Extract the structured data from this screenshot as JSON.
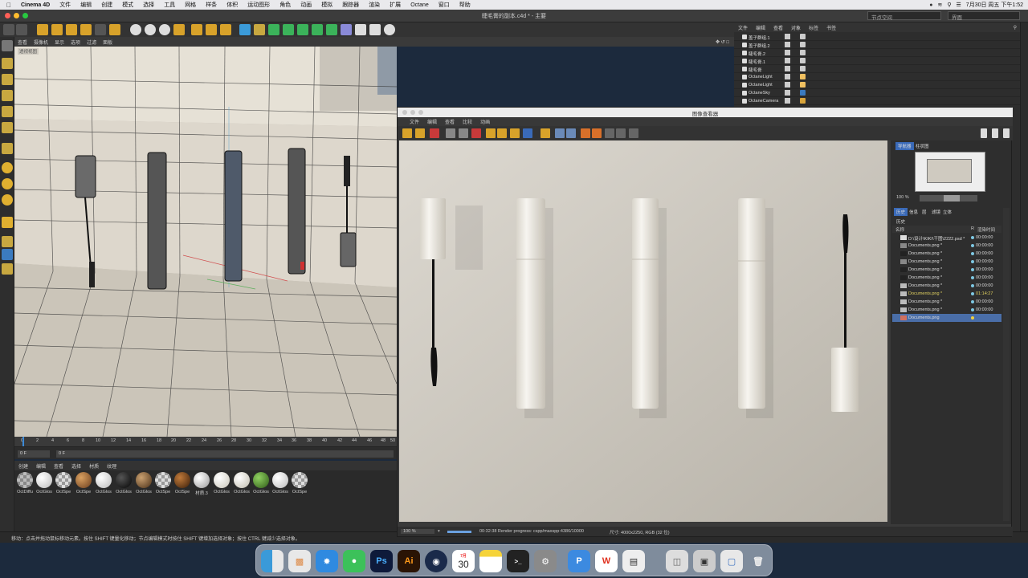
{
  "menubar": {
    "apple": "",
    "app": "Cinema 4D",
    "items": [
      "文件",
      "编辑",
      "创建",
      "模式",
      "选择",
      "工具",
      "网格",
      "样条",
      "体积",
      "运动图形",
      "角色",
      "动画",
      "模拟",
      "跟踪器",
      "渲染",
      "扩展",
      "Octane",
      "窗口",
      "帮助"
    ],
    "clock": "7月30日 周五 下午1:52"
  },
  "window": {
    "title": "睫毛膏的副本.c4d * - 主要",
    "search_left": "节点空间",
    "search_right": "界面"
  },
  "viewport": {
    "menu": [
      "查看",
      "摄像机",
      "显示",
      "选项",
      "过滤",
      "面板"
    ],
    "corner_label": "透视视图"
  },
  "timeline": {
    "ticks": [
      "0",
      "2",
      "4",
      "6",
      "8",
      "10",
      "12",
      "14",
      "16",
      "18",
      "20",
      "22",
      "24",
      "26",
      "28",
      "30",
      "32",
      "34",
      "36",
      "38",
      "40",
      "42",
      "44",
      "46",
      "48",
      "50"
    ],
    "frame_start": "0 F",
    "frame_current": "0 F"
  },
  "material_manager": {
    "menu": [
      "创建",
      "编辑",
      "查看",
      "选择",
      "材质",
      "纹理"
    ],
    "materials": [
      {
        "label": "OctDiffu",
        "color": "#9a9a9a"
      },
      {
        "label": "OctGlos",
        "color": "#e6e6e6"
      },
      {
        "label": "OctSpe",
        "color": "#bfbfbf"
      },
      {
        "label": "OctSpe",
        "color": "#8a5a2b"
      },
      {
        "label": "OctGlos",
        "color": "#e8e8e8"
      },
      {
        "label": "OctGlos",
        "color": "#1a1a1a"
      },
      {
        "label": "OctGlos",
        "color": "#7a5a35"
      },
      {
        "label": "OctSpe",
        "color": "#bdbdbd"
      },
      {
        "label": "OctSpe",
        "color": "#6b3e1e"
      },
      {
        "label": "材质.3",
        "color": "#cfcfcf"
      },
      {
        "label": "OctGlos",
        "color": "#e2e0da"
      },
      {
        "label": "OctGlos",
        "color": "#dcd9d0"
      },
      {
        "label": "OctGlos",
        "color": "#4f8a2e"
      },
      {
        "label": "OctGlos",
        "color": "#e4e4e4"
      },
      {
        "label": "OctSpe",
        "color": "#bcbcbc"
      }
    ]
  },
  "statusbar": {
    "text": "移动：点击并拖动鼠标移动元素。按住 SHIFT 键量化移动；节点编辑模式时按住 SHIFT 键增加选择对象；按住 CTRL 键减少选择对象。"
  },
  "object_manager": {
    "menu": [
      "文件",
      "编辑",
      "查看",
      "对象",
      "标签",
      "书签"
    ],
    "objects": [
      {
        "name": "盖子群组.1",
        "tag": "#cccccc"
      },
      {
        "name": "盖子群组.2",
        "tag": "#cccccc"
      },
      {
        "name": "睫毛膏.2",
        "tag": "#cccccc"
      },
      {
        "name": "睫毛膏.1",
        "tag": "#cccccc"
      },
      {
        "name": "睫毛膏",
        "tag": "#cccccc"
      },
      {
        "name": "OctaneLight",
        "tag": "#f0c060"
      },
      {
        "name": "OctaneLight",
        "tag": "#f0c060"
      },
      {
        "name": "OctaneSky",
        "tag": "#3a7abf"
      },
      {
        "name": "OctaneCamera",
        "tag": "#d9a43a"
      }
    ]
  },
  "picture_viewer": {
    "title": "图像查看器",
    "menu": [
      "文件",
      "编辑",
      "查看",
      "比较",
      "动画"
    ],
    "side_tabs": [
      "导航器",
      "柱状图"
    ],
    "zoom_small": "100 %",
    "info_tabs": [
      "历史",
      "信息",
      "层",
      "滤镜",
      "立体"
    ],
    "history_label": "历史",
    "history_cols": {
      "name": "名称",
      "r": "R",
      "time": "渲染时间"
    },
    "history": [
      {
        "name": "D:\\设计\\KIKI\\干图\\2222.psd *",
        "dot": "#7ec8e3",
        "time": "00:00:00"
      },
      {
        "name": "Documents.png *",
        "dot": "#7ec8e3",
        "time": "00:00:00"
      },
      {
        "name": "Documents.png *",
        "dot": "#7ec8e3",
        "time": "00:00:00"
      },
      {
        "name": "Documents.png *",
        "dot": "#7ec8e3",
        "time": "00:00:00"
      },
      {
        "name": "Documents.png *",
        "dot": "#7ec8e3",
        "time": "00:00:00"
      },
      {
        "name": "Documents.png *",
        "dot": "#7ec8e3",
        "time": "00:00:00"
      },
      {
        "name": "Documents.png *",
        "dot": "#7ec8e3",
        "time": "00:00:00"
      },
      {
        "name": "Documents.png *",
        "dot": "#7ec8e3",
        "time": "01:14:27",
        "highlight": "#e0d060"
      },
      {
        "name": "Documents.png *",
        "dot": "#7ec8e3",
        "time": "00:00:00"
      },
      {
        "name": "Documents.png *",
        "dot": "#7ec8e3",
        "time": "00:00:00"
      },
      {
        "name": "Documents.png",
        "dot": "#f0d040",
        "time": "",
        "selected": true
      }
    ],
    "zoom": "100 %",
    "render_progress": "00:32:38 Render progress: cspp/maxspp:4386/10000",
    "size_info": "尺寸: 4000x2250, RGB (32 位)"
  },
  "dock": {
    "calendar_month": "7月",
    "calendar_day": "30",
    "apps": [
      "finder",
      "launchpad",
      "safari",
      "wechat",
      "photoshop",
      "illustrator",
      "cinema4d",
      "calendar",
      "notes",
      "terminal",
      "system-preferences",
      "wps-p",
      "wps",
      "scanner",
      "document",
      "preview",
      "screenshot",
      "trash"
    ]
  }
}
